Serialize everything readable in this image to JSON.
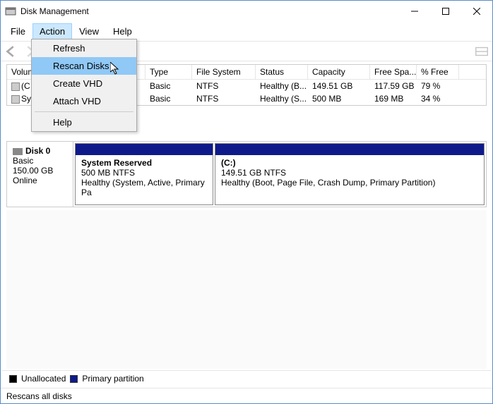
{
  "window": {
    "title": "Disk Management"
  },
  "menubar": {
    "file": "File",
    "action": "Action",
    "view": "View",
    "help": "Help"
  },
  "action_menu": {
    "refresh": "Refresh",
    "rescan_disks": "Rescan Disks",
    "create_vhd": "Create VHD",
    "attach_vhd": "Attach VHD",
    "help": "Help"
  },
  "table_headers": {
    "volume": "Volum",
    "type": "Type",
    "file_system": "File System",
    "status": "Status",
    "capacity": "Capacity",
    "free_space": "Free Spa...",
    "pct_free": "% Free"
  },
  "volumes": [
    {
      "name": "(C",
      "type": "Basic",
      "fs": "NTFS",
      "status": "Healthy (B...",
      "capacity": "149.51 GB",
      "free": "117.59 GB",
      "pct": "79 %"
    },
    {
      "name": "Sys",
      "type": "Basic",
      "fs": "NTFS",
      "status": "Healthy (S...",
      "capacity": "500 MB",
      "free": "169 MB",
      "pct": "34 %"
    }
  ],
  "disk": {
    "name": "Disk 0",
    "type": "Basic",
    "size": "150.00 GB",
    "status": "Online"
  },
  "partitions": [
    {
      "name": "System Reserved",
      "size": "500 MB NTFS",
      "status": "Healthy (System, Active, Primary Pa"
    },
    {
      "name": "(C:)",
      "size": "149.51 GB NTFS",
      "status": "Healthy (Boot, Page File, Crash Dump, Primary Partition)"
    }
  ],
  "legend": {
    "unallocated": "Unallocated",
    "primary": "Primary partition"
  },
  "statusbar": {
    "text": "Rescans all disks"
  }
}
